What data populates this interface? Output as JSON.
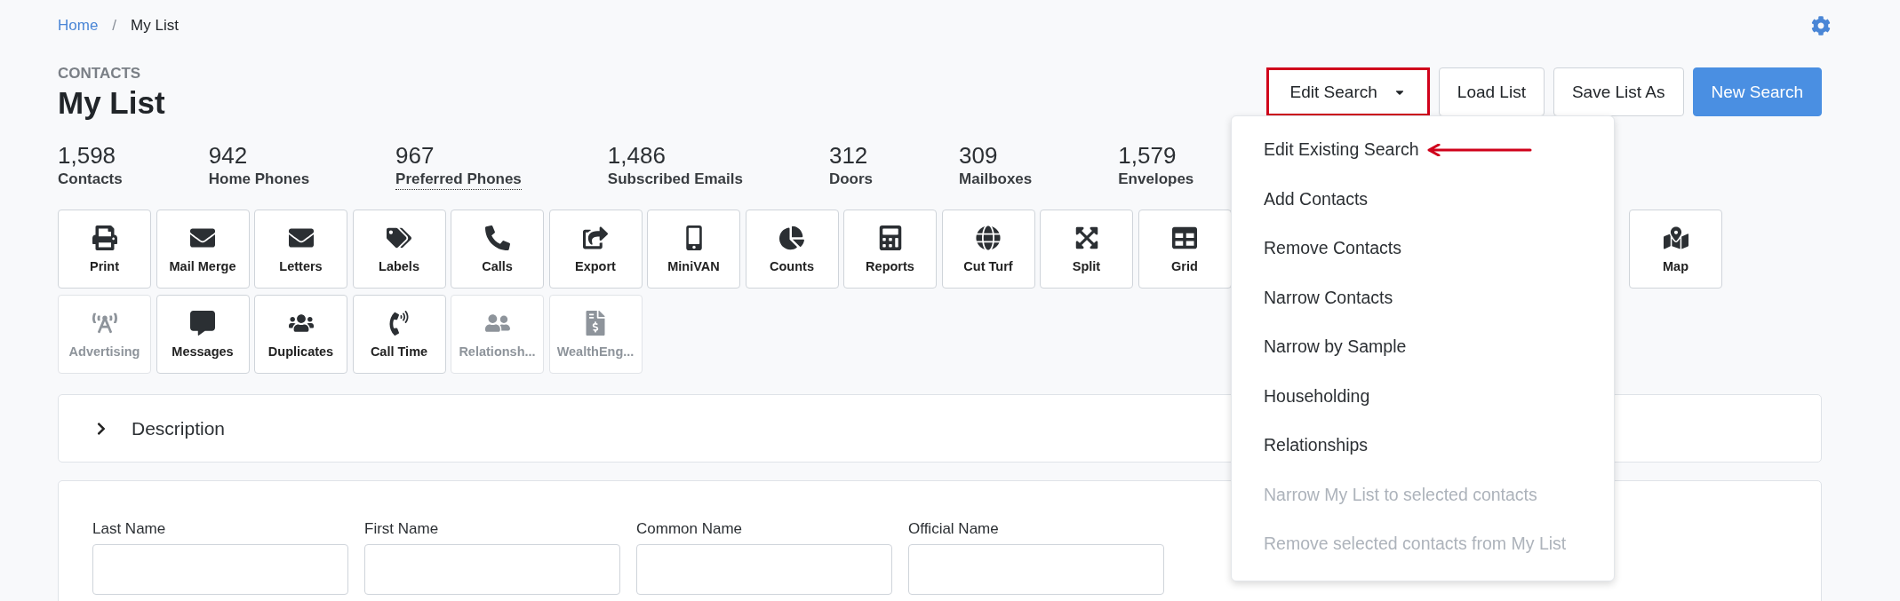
{
  "breadcrumb": [
    {
      "label": "Home",
      "link": true
    },
    {
      "label": "My List",
      "link": false
    }
  ],
  "breadcrumb_separator": "/",
  "section_label": "CONTACTS",
  "title": "My List",
  "actions": [
    {
      "label": "Edit Search",
      "kind": "dropdown",
      "outlined": true,
      "primary": false
    },
    {
      "label": "Load List",
      "kind": "button",
      "outlined": false,
      "primary": false
    },
    {
      "label": "Save List As",
      "kind": "button",
      "outlined": false,
      "primary": false
    },
    {
      "label": "New Search",
      "kind": "button",
      "outlined": false,
      "primary": true
    }
  ],
  "dropdown_menu": [
    {
      "label": "Edit Existing Search",
      "disabled": false,
      "pointed": true
    },
    {
      "label": "Add Contacts",
      "disabled": false,
      "pointed": false
    },
    {
      "label": "Remove Contacts",
      "disabled": false,
      "pointed": false
    },
    {
      "label": "Narrow Contacts",
      "disabled": false,
      "pointed": false
    },
    {
      "label": "Narrow by Sample",
      "disabled": false,
      "pointed": false
    },
    {
      "label": "Householding",
      "disabled": false,
      "pointed": false
    },
    {
      "label": "Relationships",
      "disabled": false,
      "pointed": false
    },
    {
      "label": "Narrow My List to selected contacts",
      "disabled": true,
      "pointed": false
    },
    {
      "label": "Remove selected contacts from My List",
      "disabled": true,
      "pointed": false
    }
  ],
  "stats": [
    {
      "value": "1,598",
      "label": "Contacts",
      "underlined": false
    },
    {
      "value": "942",
      "label": "Home Phones",
      "underlined": false
    },
    {
      "value": "967",
      "label": "Preferred Phones",
      "underlined": true
    },
    {
      "value": "1,486",
      "label": "Subscribed Emails",
      "underlined": false
    },
    {
      "value": "312",
      "label": "Doors",
      "underlined": false
    },
    {
      "value": "309",
      "label": "Mailboxes",
      "underlined": false
    },
    {
      "value": "1,579",
      "label": "Envelopes",
      "underlined": false
    }
  ],
  "tool_rows": [
    [
      {
        "label": "Print",
        "disabled": false
      },
      {
        "label": "Mail Merge",
        "disabled": false
      },
      {
        "label": "Letters",
        "disabled": false
      },
      {
        "label": "Labels",
        "disabled": false
      },
      {
        "label": "Calls",
        "disabled": false
      },
      {
        "label": "Export",
        "disabled": false
      },
      {
        "label": "MiniVAN",
        "disabled": false
      },
      {
        "label": "Counts",
        "disabled": false
      },
      {
        "label": "Reports",
        "disabled": false
      },
      {
        "label": "Cut Turf",
        "disabled": false
      },
      {
        "label": "Split",
        "disabled": false
      },
      {
        "label": "Grid",
        "disabled": false
      },
      {
        "label": "Map",
        "disabled": false
      }
    ],
    [
      {
        "label": "Advertising",
        "disabled": true
      },
      {
        "label": "Messages",
        "disabled": false
      },
      {
        "label": "Duplicates",
        "disabled": false
      },
      {
        "label": "Call Time",
        "disabled": false
      },
      {
        "label": "Relationsh...",
        "disabled": true
      },
      {
        "label": "WealthEng...",
        "disabled": true
      }
    ]
  ],
  "description_panel": {
    "title": "Description",
    "expanded": false
  },
  "form_fields": [
    {
      "label": "Last Name"
    },
    {
      "label": "First Name"
    },
    {
      "label": "Common Name"
    },
    {
      "label": "Official Name"
    }
  ]
}
